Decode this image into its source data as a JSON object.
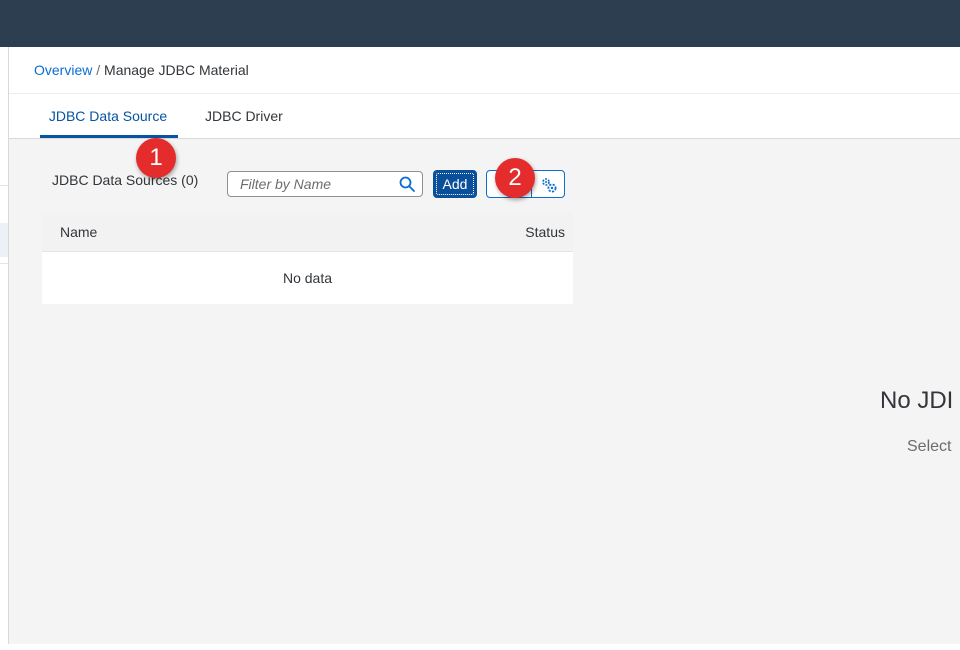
{
  "breadcrumb": {
    "link": "Overview",
    "separator": "/",
    "current": "Manage JDBC Material"
  },
  "tabs": [
    {
      "label": "JDBC Data Source",
      "active": true
    },
    {
      "label": "JDBC Driver",
      "active": false
    }
  ],
  "toolbar": {
    "list_title": "JDBC Data Sources (0)",
    "search_placeholder": "Filter by Name",
    "search_icon": "search-icon",
    "add_label": "Add",
    "settings_icon": "settings-icon"
  },
  "table": {
    "columns": [
      "Name",
      "Status"
    ],
    "empty_text": "No data"
  },
  "detail": {
    "empty_title": "No JDI",
    "empty_subtitle": "Select"
  },
  "annotations": {
    "marker_1": "1",
    "marker_2": "2"
  },
  "colors": {
    "shell": "#2c3e50",
    "accent": "#0a6ed1",
    "emphasized_button": "#0a4f9a",
    "marker": "#e42c2c"
  }
}
